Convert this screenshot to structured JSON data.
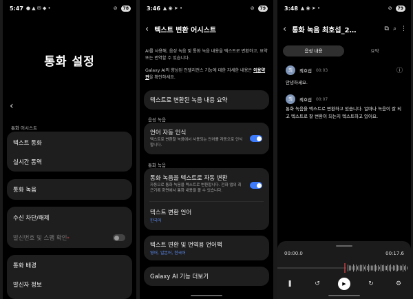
{
  "screen1": {
    "time": "5:47",
    "battery": "78",
    "title": "통화 설정",
    "section_label": "통화 어시스트",
    "items": [
      "텍스트 통화",
      "실시간 통역",
      "통화 녹음",
      "수신 차단/해제",
      "발신번호 및 스팸 확인",
      "통화 배경",
      "발신자 정보"
    ],
    "spam_toggle": false
  },
  "screen2": {
    "time": "3:46",
    "battery": "79",
    "title": "텍스트 변환 어시스트",
    "intro": "AI를 사용해, 음성 녹음 및 통화 녹음 내용을 텍스트로 변환하고, 요약 또는 번역할 수 있습니다.",
    "more_info_pre": "Galaxy AI의 향상된 인텔리전스 기능에 대한 자세한 내용은 ",
    "more_info_link": "이용약관",
    "more_info_post": "을 확인하세요.",
    "summary_item": "텍스트로 변환된 녹음 내용 요약",
    "voice_section": "음성 녹음",
    "lang_detect_title": "언어 자동 인식",
    "lang_detect_desc": "텍스트로 변환할 녹음에서 사용되는 언어를 자동으로 인식합니다.",
    "lang_detect_on": true,
    "call_section": "통화 녹음",
    "auto_convert_title": "통화 녹음을 텍스트로 자동 변환",
    "auto_convert_desc": "자동으로 통화 녹음을 텍스트로 변환합니다. 전화 앱의 최근기록 화면에서 통화 내용을 볼 수 있습니다.",
    "auto_convert_on": true,
    "convert_lang_title": "텍스트 변환 언어",
    "convert_lang_value": "한국어",
    "pack_title": "텍스트 변환 및 번역용 언어팩",
    "pack_value": "영어, 일본어, 한국어",
    "more_features": "Galaxy AI 기능 더보기"
  },
  "screen3": {
    "time": "3:48",
    "battery": "79",
    "title": "통화 녹음 최호섭_2…",
    "tab_voice": "음성 내용",
    "tab_summary": "요약",
    "messages": [
      {
        "avatar": "최",
        "speaker": "최호섭",
        "time": "00:03",
        "text": "안녕하세요."
      },
      {
        "avatar": "최",
        "speaker": "최호섭",
        "time": "00:07",
        "text": "통화 녹음을 텍스트로 변환하고 있습니다. 얼마나 녹음이 잘 되고 텍스트로 잘 변환이 되는지 텍스트하고 있어요."
      }
    ],
    "current_time": "00:00.0",
    "total_time": "00:17.6"
  }
}
